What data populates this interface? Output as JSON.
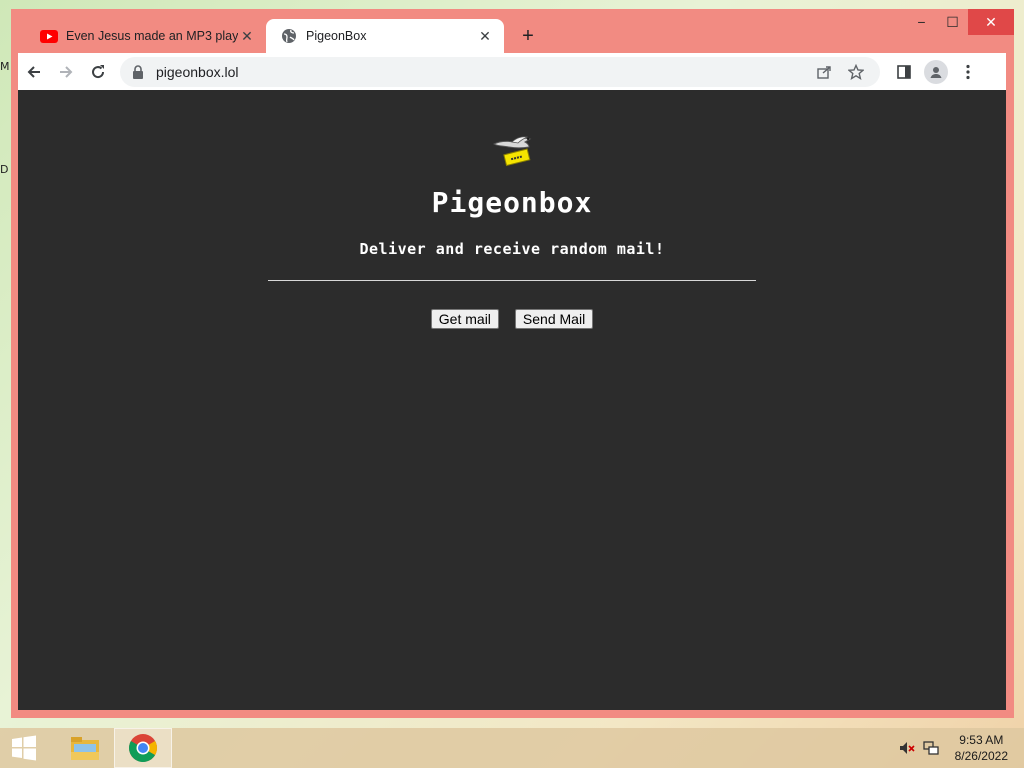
{
  "desktop": {
    "stub_top": "M",
    "stub_mid": "D"
  },
  "window": {
    "controls": {
      "minimize": "−",
      "maximize": "☐",
      "close": "✕"
    }
  },
  "tabs": [
    {
      "title": "Even Jesus made an MP3 player",
      "close": "✕",
      "active": false,
      "favicon": "youtube-icon"
    },
    {
      "title": "PigeonBox",
      "close": "✕",
      "active": true,
      "favicon": "globe-icon"
    }
  ],
  "new_tab_label": "+",
  "toolbar": {
    "url": "pigeonbox.lol"
  },
  "page": {
    "title": "Pigeonbox",
    "tagline": "Deliver and receive random mail!",
    "buttons": {
      "get_mail": "Get mail",
      "send_mail": "Send Mail"
    }
  },
  "taskbar": {
    "time": "9:53 AM",
    "date": "8/26/2022"
  },
  "colors": {
    "window_frame": "#f28b82",
    "page_bg": "#2c2c2c",
    "close_button": "#e04848"
  }
}
